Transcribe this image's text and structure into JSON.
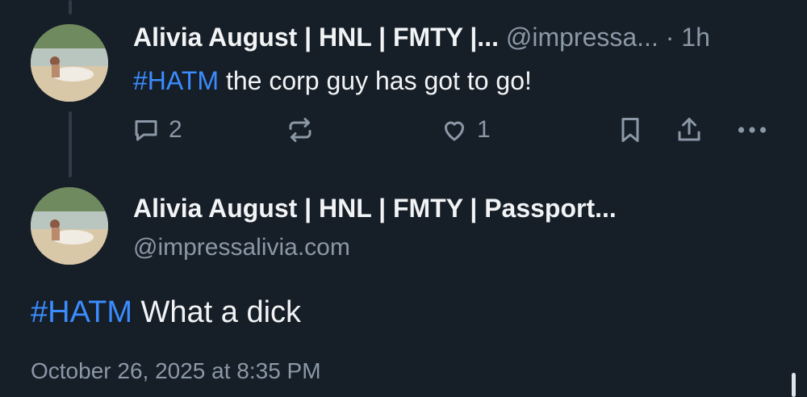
{
  "reply": {
    "author_name": "Alivia August | HNL | FMTY |...",
    "handle": "@impressa...",
    "separator": "·",
    "time": "1h",
    "hashtag": "#HATM",
    "text": " the corp guy has got to go!",
    "reply_count": "2",
    "like_count": "1"
  },
  "main_post": {
    "author_name": "Alivia August | HNL | FMTY | Passport...",
    "handle": "@impressalivia.com",
    "hashtag": "#HATM",
    "text": " What a dick",
    "timestamp": "October 26, 2025 at 8:35 PM"
  },
  "icons": [
    "reply-icon",
    "repost-icon",
    "like-icon",
    "bookmark-icon",
    "share-icon",
    "more-icon"
  ],
  "colors": {
    "background": "#161e27",
    "hashtag": "#3b8cff",
    "muted": "#8b98a7",
    "text": "#f1f3f5"
  }
}
